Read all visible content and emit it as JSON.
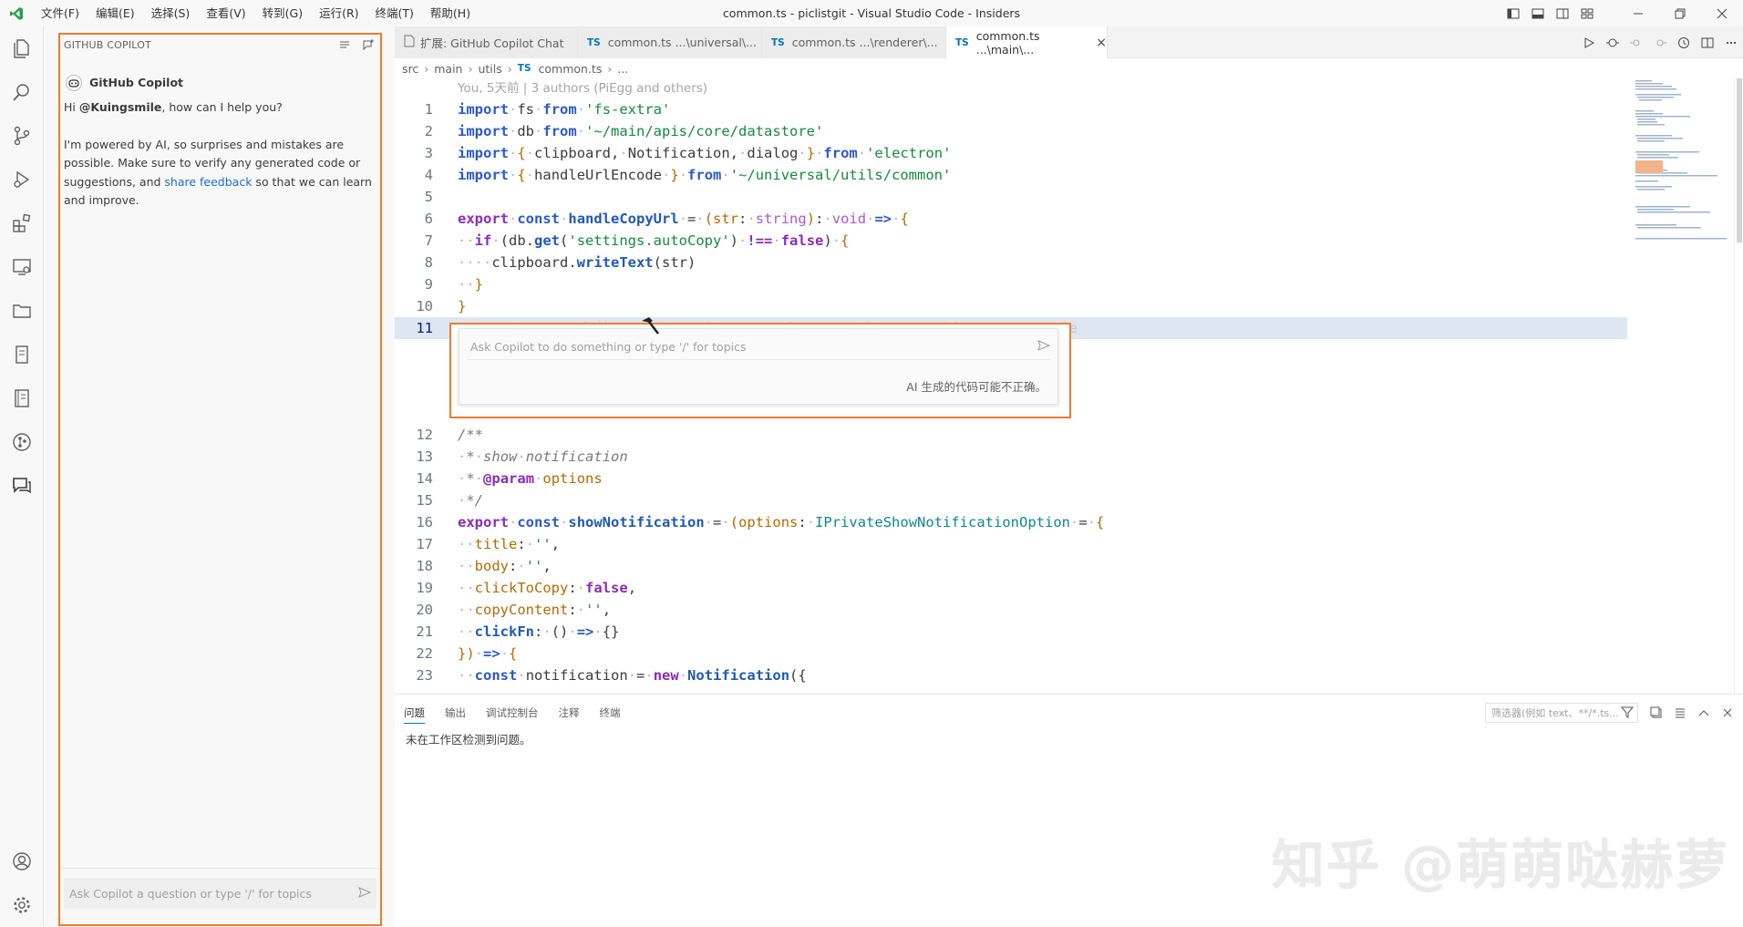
{
  "titlebar": {
    "menu": [
      "文件(F)",
      "编辑(E)",
      "选择(S)",
      "查看(V)",
      "转到(G)",
      "运行(R)",
      "终端(T)",
      "帮助(H)"
    ],
    "window_title": "common.ts - piclistgit - Visual Studio Code - Insiders"
  },
  "sidebar": {
    "title": "GITHUB COPILOT",
    "bot_name": "GitHub Copilot",
    "greeting_prefix": "Hi ",
    "greeting_user": "@Kuingsmile",
    "greeting_suffix": ", how can I help you?",
    "notice_1": "I'm powered by AI, so surprises and mistakes are possible. Make sure to verify any generated code or suggestions, and ",
    "notice_link": "share feedback",
    "notice_2": " so that we can learn and improve.",
    "input_placeholder": "Ask Copilot a question or type '/' for topics"
  },
  "tabs": [
    {
      "badge": "",
      "label": "扩展: GitHub Copilot Chat",
      "close": ""
    },
    {
      "badge": "TS",
      "label": "common.ts ...\\universal\\...",
      "close": ""
    },
    {
      "badge": "TS",
      "label": "common.ts ...\\renderer\\...",
      "close": ""
    },
    {
      "badge": "TS",
      "label": "common.ts ...\\main\\...",
      "close": "×"
    }
  ],
  "breadcrumb": {
    "items": [
      "src",
      "main",
      "utils"
    ],
    "file_badge": "TS",
    "file": "common.ts",
    "trail": "..."
  },
  "editor": {
    "blame_header": "You, 5天前 | 3 authors (PiEgg and others)",
    "current_line_ghost": "PiEgg, 2年前 · :art: Refactor: unload module as notification module",
    "line_numbers": [
      "1",
      "2",
      "3",
      "4",
      "5",
      "6",
      "7",
      "8",
      "9",
      "10",
      "11",
      "12",
      "13",
      "14",
      "15",
      "16",
      "17",
      "18",
      "19",
      "20",
      "21",
      "22",
      "23"
    ]
  },
  "inline_chat": {
    "placeholder": "Ask Copilot to do something or type '/' for topics",
    "note": "AI 生成的代码可能不正确。"
  },
  "panel": {
    "tabs": [
      "问题",
      "输出",
      "调试控制台",
      "注释",
      "终端"
    ],
    "filter_placeholder": "筛选器(例如 text、**/*.ts...",
    "message": "未在工作区检测到问题。"
  },
  "watermark": "知乎 @萌萌哒赫萝",
  "colors": {
    "highlight_border": "#f07b2e",
    "keyword": "#2b59c9",
    "string": "#15893e",
    "current_line": "#dde6f1"
  }
}
